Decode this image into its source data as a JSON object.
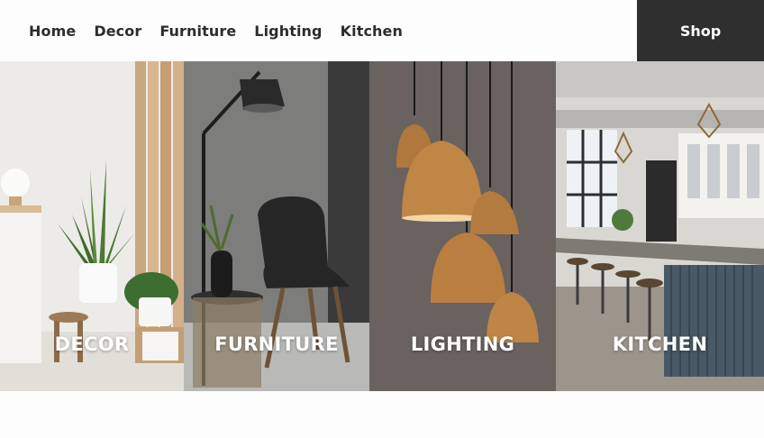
{
  "nav": {
    "items": [
      {
        "label": "Home"
      },
      {
        "label": "Decor"
      },
      {
        "label": "Furniture"
      },
      {
        "label": "Lighting"
      },
      {
        "label": "Kitchen"
      }
    ],
    "shop_label": "Shop"
  },
  "panels": [
    {
      "label": "DECOR"
    },
    {
      "label": "FURNITURE"
    },
    {
      "label": "LIGHTING"
    },
    {
      "label": "KITCHEN"
    }
  ],
  "colors": {
    "header_bg": "#fdfdfd",
    "shop_bg": "#2f2f2f",
    "nav_text": "#2d2d2d",
    "label_text": "#ffffff"
  }
}
